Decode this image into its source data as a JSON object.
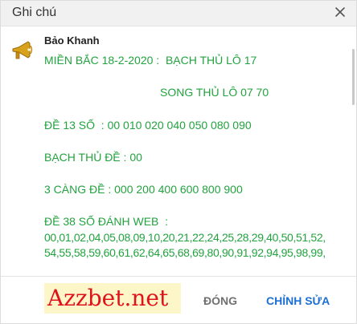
{
  "dialog": {
    "title": "Ghi chú",
    "close_icon": "close-icon"
  },
  "note": {
    "author": "Bảo Khanh",
    "avatar_icon": "megaphone-icon",
    "lines": [
      "MIỀN BẮC 18-2-2020 :  BẠCH THỦ LÔ 17",
      "SONG THỦ LÔ 07 70",
      "ĐỀ 13 SỐ  : 00 010 020 040 050 080 090",
      "BẠCH THỦ ĐỀ : 00",
      "3 CÀNG ĐỀ : 000 200 400 600 800 900",
      "ĐỀ 38 SỐ ĐÁNH WEB  :",
      "00,01,02,04,05,08,09,10,20,21,22,24,25,28,29,40,50,51,52,",
      "54,55,58,59,60,61,62,64,65,68,69,80,90,91,92,94,95,98,99,"
    ],
    "text_color": "#22a33f"
  },
  "footer": {
    "watermark": "Azzbet.net",
    "close_label": "ĐÓNG",
    "edit_label": "CHỈNH SỬA",
    "edit_color": "#1d6fd1"
  }
}
